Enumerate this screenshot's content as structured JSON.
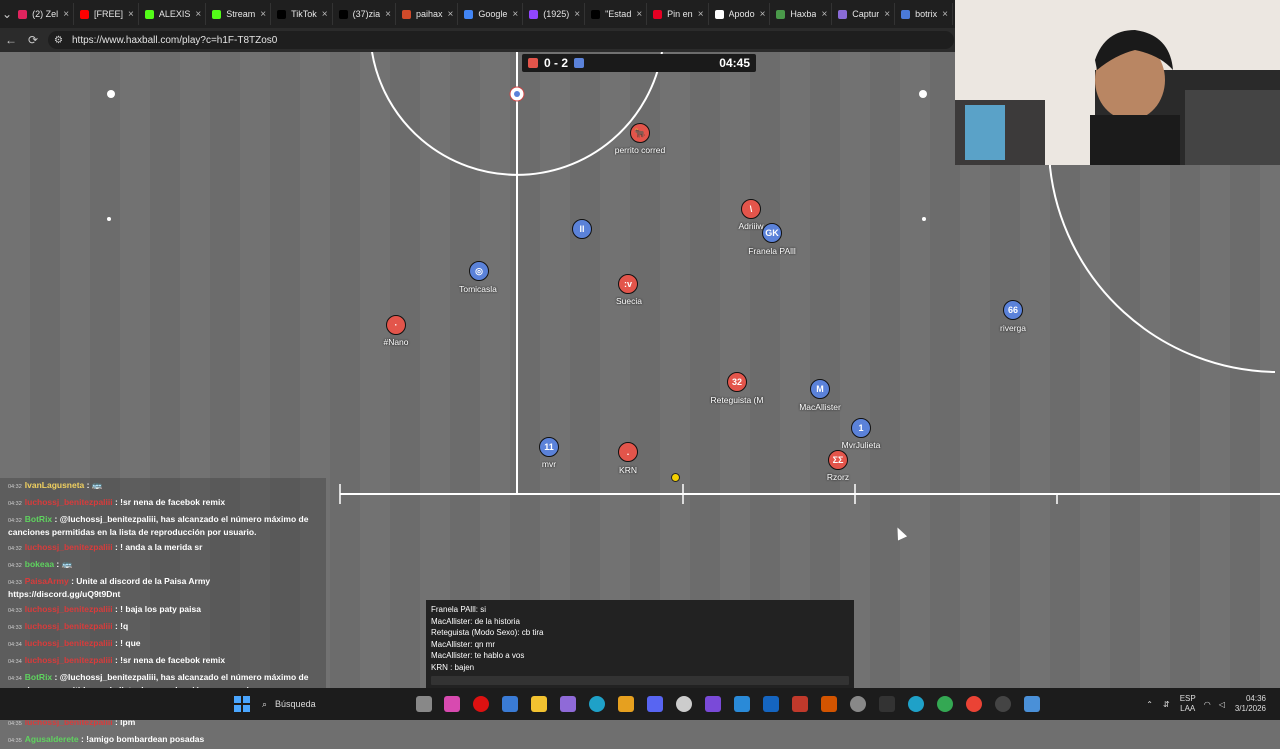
{
  "browser": {
    "tabs": [
      {
        "label": "(2) Zel",
        "color": "#e0245e"
      },
      {
        "label": "[FREE]",
        "color": "#ff0000"
      },
      {
        "label": "ALEXIS",
        "color": "#53fc18"
      },
      {
        "label": "Stream",
        "color": "#53fc18"
      },
      {
        "label": "TikTok",
        "color": "#000000"
      },
      {
        "label": "(37)zia",
        "color": "#000000"
      },
      {
        "label": "paihax",
        "color": "#d04a2a"
      },
      {
        "label": "Google",
        "color": "#4285f4"
      },
      {
        "label": "(1925)",
        "color": "#9146ff"
      },
      {
        "label": "\"Estad",
        "color": "#000000"
      },
      {
        "label": "Pin en",
        "color": "#e60023"
      },
      {
        "label": "Apodo",
        "color": "#ffffff"
      },
      {
        "label": "Haxba",
        "color": "#4a9a4a"
      },
      {
        "label": "Captur",
        "color": "#8a6bd8"
      },
      {
        "label": "botrix",
        "color": "#4a7ad8"
      }
    ],
    "url": "https://www.haxball.com/play?c=h1F-T8TZos0"
  },
  "scoreboard": {
    "score": "0 - 2",
    "time": "04:45",
    "red_color": "#e3554b",
    "blue_color": "#5b82d9"
  },
  "players": [
    {
      "name": "perrito corred",
      "avatar": "🐂",
      "team": "red"
    },
    {
      "name": "Adriiiw",
      "avatar": "\\",
      "team": "red"
    },
    {
      "name": "Franela PAlll",
      "avatar": "GK",
      "team": "blue"
    },
    {
      "name": "Tomicasla",
      "avatar": "◎",
      "team": "blue"
    },
    {
      "name": "Suecia",
      "avatar": ":v",
      "team": "red"
    },
    {
      "name": "#Nano",
      "avatar": "·",
      "team": "red"
    },
    {
      "name": "rivergа",
      "avatar": "66",
      "team": "blue"
    },
    {
      "name": "Reteguista (M",
      "avatar": "32",
      "team": "red"
    },
    {
      "name": "MacAllister",
      "avatar": "M",
      "team": "blue"
    },
    {
      "name": "MvrJulieta",
      "avatar": "1",
      "team": "blue"
    },
    {
      "name": "mvr",
      "avatar": "11",
      "team": "blue"
    },
    {
      "name": "KRN",
      "avatar": ".",
      "team": "red"
    },
    {
      "name": "Rzorz",
      "avatar": "ΣΣ",
      "team": "red"
    },
    {
      "name": "",
      "avatar": "ll",
      "team": "blue"
    }
  ],
  "chat": [
    {
      "time": "04:32",
      "user": "IvanLagusneta",
      "sep": " : ",
      "text": "🚌",
      "user_class": "u-yellow"
    },
    {
      "time": "04:32",
      "user": "luchossj_benitezpaliii",
      "sep": " : ",
      "text": "!sr nena de facebok remix",
      "user_class": "u-red"
    },
    {
      "time": "04:32",
      "user": "BotRix",
      "sep": " : ",
      "text": "@luchossj_benitezpaliii, has alcanzado el número máximo de canciones permitidas en la lista de reproducción por usuario.",
      "user_class": "u-green"
    },
    {
      "time": "04:32",
      "user": "luchossj_benitezpaliii",
      "sep": " : ",
      "text": "! anda a la merida sr",
      "user_class": "u-red"
    },
    {
      "time": "04:32",
      "user": "bokeaa",
      "sep": " : ",
      "text": "🚌",
      "user_class": "u-green"
    },
    {
      "time": "04:33",
      "user": "PaisaArmy",
      "sep": " : ",
      "text": "Unite al discord de la Paisa Army https://discord.gg/uQ9t9Dnt",
      "user_class": "u-red"
    },
    {
      "time": "04:33",
      "user": "luchossj_benitezpaliii",
      "sep": " : ",
      "text": "! baja los paty paisa",
      "user_class": "u-red"
    },
    {
      "time": "04:33",
      "user": "luchossj_benitezpaliii",
      "sep": " : ",
      "text": "!q",
      "user_class": "u-red"
    },
    {
      "time": "04:34",
      "user": "luchossj_benitezpaliii",
      "sep": " : ",
      "text": "! que",
      "user_class": "u-red"
    },
    {
      "time": "04:34",
      "user": "luchossj_benitezpaliii",
      "sep": " : ",
      "text": "!sr nena de facebok remix",
      "user_class": "u-red"
    },
    {
      "time": "04:34",
      "user": "BotRix",
      "sep": " : ",
      "text": "@luchossj_benitezpaliii, has alcanzado el número máximo de canciones permitidas en la lista de reproducción por usuario.",
      "user_class": "u-green"
    },
    {
      "time": "04:35",
      "user": "luchossj_benitezpaliii",
      "sep": " : ",
      "text": "lpm)",
      "user_class": "u-red"
    },
    {
      "time": "04:35",
      "user": "luchossj_benitezpaliii",
      "sep": " : ",
      "text": "lpm",
      "user_class": "u-red"
    },
    {
      "time": "04:35",
      "user": "Agusalderete",
      "sep": " : ",
      "text": "!amigo bombardean posadas",
      "user_class": "u-green"
    }
  ],
  "ingame_chat": [
    "Franela PAlll: si",
    "MacAllister: de la historia",
    "Reteguista (Modo Sexo): cb tira",
    "MacAllister: qn mr",
    "MacAllister: te hablo a vos",
    "KRN : bajen"
  ],
  "taskbar": {
    "search_label": "Búsqueda",
    "lang": "ESP",
    "lang2": "LAA",
    "time": "04:36",
    "date": "3/1/2026"
  }
}
